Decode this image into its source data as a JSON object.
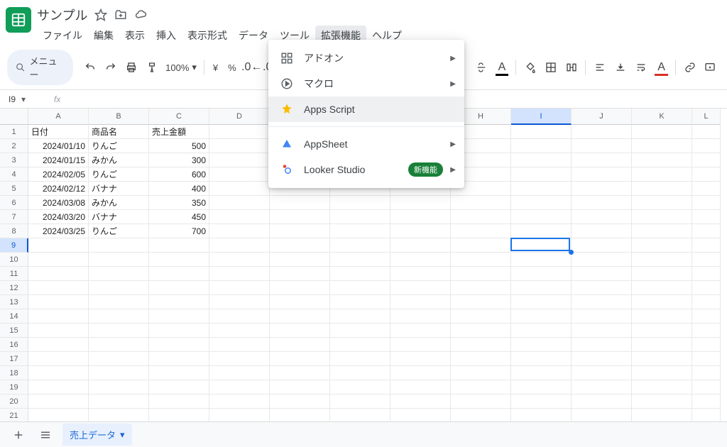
{
  "header": {
    "title": "サンプル",
    "menus": [
      "ファイル",
      "編集",
      "表示",
      "挿入",
      "表示形式",
      "データ",
      "ツール",
      "拡張機能",
      "ヘルプ"
    ],
    "active_menu_index": 7
  },
  "toolbar": {
    "search_label": "メニュー",
    "zoom": "100%",
    "currency": "¥",
    "percent": "%"
  },
  "fx": {
    "cellname": "I9",
    "formula": ""
  },
  "dropdown": {
    "items": [
      {
        "icon": "addons",
        "label": "アドオン",
        "submenu": true
      },
      {
        "icon": "macro",
        "label": "マクロ",
        "submenu": true
      },
      {
        "icon": "apps",
        "label": "Apps Script",
        "submenu": false,
        "hover": true
      },
      {
        "sep": true
      },
      {
        "icon": "appsheet",
        "label": "AppSheet",
        "submenu": true
      },
      {
        "icon": "looker",
        "label": "Looker Studio",
        "submenu": true,
        "badge": "新機能"
      }
    ]
  },
  "columns": [
    "A",
    "B",
    "C",
    "D",
    "E",
    "F",
    "G",
    "H",
    "I",
    "J",
    "K",
    "L"
  ],
  "sheet": {
    "headers": {
      "A": "日付",
      "B": "商品名",
      "C": "売上金額"
    },
    "rows": [
      {
        "A": "2024/01/10",
        "B": "りんご",
        "C": "500"
      },
      {
        "A": "2024/01/15",
        "B": "みかん",
        "C": "300"
      },
      {
        "A": "2024/02/05",
        "B": "りんご",
        "C": "600"
      },
      {
        "A": "2024/02/12",
        "B": "バナナ",
        "C": "400"
      },
      {
        "A": "2024/03/08",
        "B": "みかん",
        "C": "350"
      },
      {
        "A": "2024/03/20",
        "B": "バナナ",
        "C": "450"
      },
      {
        "A": "2024/03/25",
        "B": "りんご",
        "C": "700"
      }
    ],
    "row_count": 24,
    "active_cell": {
      "col": "I",
      "row": 9
    }
  },
  "bottom": {
    "sheet_name": "売上データ"
  }
}
